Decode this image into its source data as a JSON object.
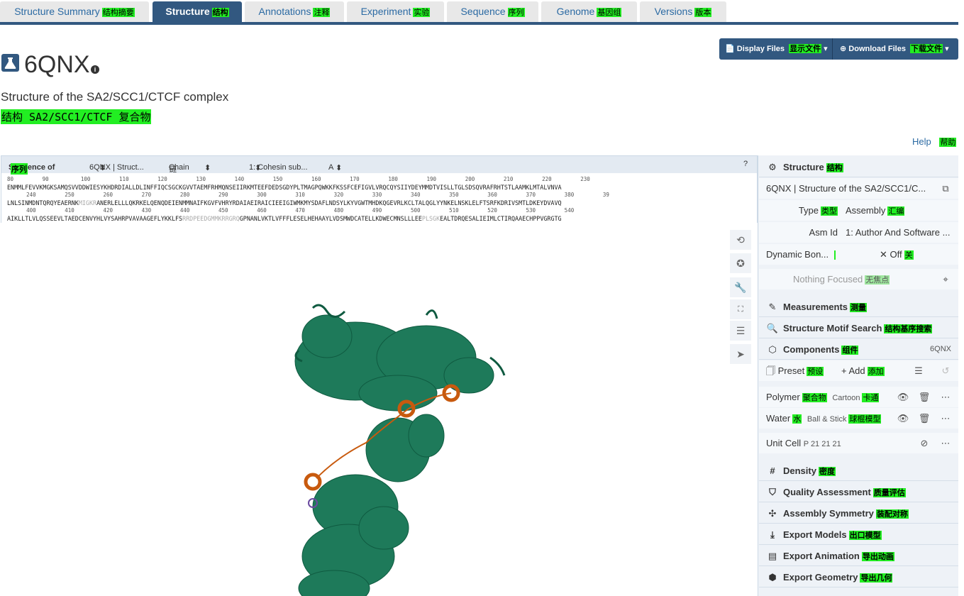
{
  "tabs": [
    {
      "label": "Structure Summary",
      "zh": "结构摘要",
      "active": false
    },
    {
      "label": "Structure",
      "zh": "结构",
      "active": true
    },
    {
      "label": "Annotations",
      "zh": "注释",
      "active": false
    },
    {
      "label": "Experiment",
      "zh": "实验",
      "active": false
    },
    {
      "label": "Sequence",
      "zh": "序列",
      "active": false
    },
    {
      "label": "Genome",
      "zh": "基因组",
      "active": false
    },
    {
      "label": "Versions",
      "zh": "版本",
      "active": false
    }
  ],
  "header": {
    "id": "6QNX",
    "subtitle": "Structure of the SA2/SCC1/CTCF complex",
    "subtitle_zh": "结构 SA2/SCC1/CTCF 复合物"
  },
  "buttons": {
    "display_files": "Display Files",
    "display_files_zh": "显示文件",
    "download_files": "Download Files",
    "download_files_zh": "下载文件"
  },
  "help": {
    "label": "Help",
    "zh": "帮助"
  },
  "sequence_bar": {
    "label": "Sequence of",
    "label_zh": "序列",
    "structure_select": "6QNX | Struct...",
    "chain_label": "Chain",
    "chain_zh": "链",
    "entity_select": "1: Cohesin sub...",
    "chain_select": "A"
  },
  "sequence": {
    "nums1": "80         90          100         110         120         130         140         150         160         170         180         190         200         210         220         230",
    "line1": "ENMMLFEVVKMGKSAMQSVVDDWIESYKHDRDIALLDLINFFIQCSGCKGVVTAEMFRHMQNSEIIRKMTEEFDEDSGDYPLTMAGPQWKKFKSSFCEFIGVLVRQCQYSIIYDEYMMDTVISLLTGLSDSQVRAFRHTSTLAAMKLMTALVNVA",
    "nums2": "      240         250         260         270         280         290         300         310         320         330         340         350         360         370         380         39",
    "line2a": "LNLSINMDNTQRQYEAERNK",
    "line2b": "MIGKR",
    "line2c": "ANERLELLLQKRKELQENQDEIENMMNAIFKGVFVHRYRDAIAEIRAICIEEIGIWMKMYSDAFLNDSYLKYVGWTMHDKQGEVRLKCLTALQGLYYNKELNSKLELFTSRFKDRIVSMTLDKEYDVAVQ",
    "nums3": "      400         410         420         430         440         450         460         470         480         490         500         510         520         530         540",
    "line3a": "AIKLLTLVLQSSEEVLTAEDCENVYHLVYSAHRPVAVAAGEFLYKKLFS",
    "line3b": "RRDPEEDGMMKRRGRQ",
    "line3c": "GPNANLVKTLVFFFLESELHEHAAYLVDSMWDCATELLKDWECMNSLLLEE",
    "line3d": "PLSGK",
    "line3e": "EALTDRQESALIEIMLCTIRQAAECHPPVGRGTG"
  },
  "viewer_tools": [
    "reset-icon",
    "spin-icon",
    "settings-icon",
    "expand-icon",
    "controls-icon",
    "select-icon"
  ],
  "right_panel": {
    "structure_title": "Structure",
    "structure_zh": "结构",
    "structure_select": "6QNX | Structure of the SA2/SCC1/C...",
    "type_label": "Type",
    "type_zh": "类型",
    "type_value": "Assembly",
    "type_value_zh": "汇编",
    "asm_label": "Asm Id",
    "asm_value": "1: Author And Software ...",
    "dynamic_label": "Dynamic Bon...",
    "dynamic_value": "Off",
    "dynamic_value_zh": "关",
    "focus_text": "Nothing Focused",
    "focus_zh": "无焦点",
    "measurements": "Measurements",
    "measurements_zh": "测量",
    "motif": "Structure Motif Search",
    "motif_zh": "结构基序搜索",
    "components": "Components",
    "components_zh": "组件",
    "components_id": "6QNX",
    "preset": "Preset",
    "preset_zh": "预设",
    "add": "Add",
    "add_zh": "添加",
    "polymer": "Polymer",
    "polymer_zh": "聚合物",
    "polymer_repr": "Cartoon",
    "polymer_repr_zh": "卡通",
    "water": "Water",
    "water_zh": "水",
    "water_repr": "Ball & Stick",
    "water_repr_zh": "球棍模型",
    "unit_cell": "Unit Cell",
    "unit_cell_sg": "P 21 21 21",
    "density": "Density",
    "density_zh": "密度",
    "quality": "Quality Assessment",
    "quality_zh": "质量评估",
    "symmetry": "Assembly Symmetry",
    "symmetry_zh": "装配对称",
    "export_models": "Export Models",
    "export_models_zh": "出口模型",
    "export_animation": "Export Animation",
    "export_animation_zh": "导出动画",
    "export_geometry": "Export Geometry",
    "export_geometry_zh": "导出几何"
  },
  "colors": {
    "primary": "#325880",
    "highlight": "#22ee22",
    "protein_green": "#1e7a5a",
    "protein_orange": "#c85a0e"
  }
}
